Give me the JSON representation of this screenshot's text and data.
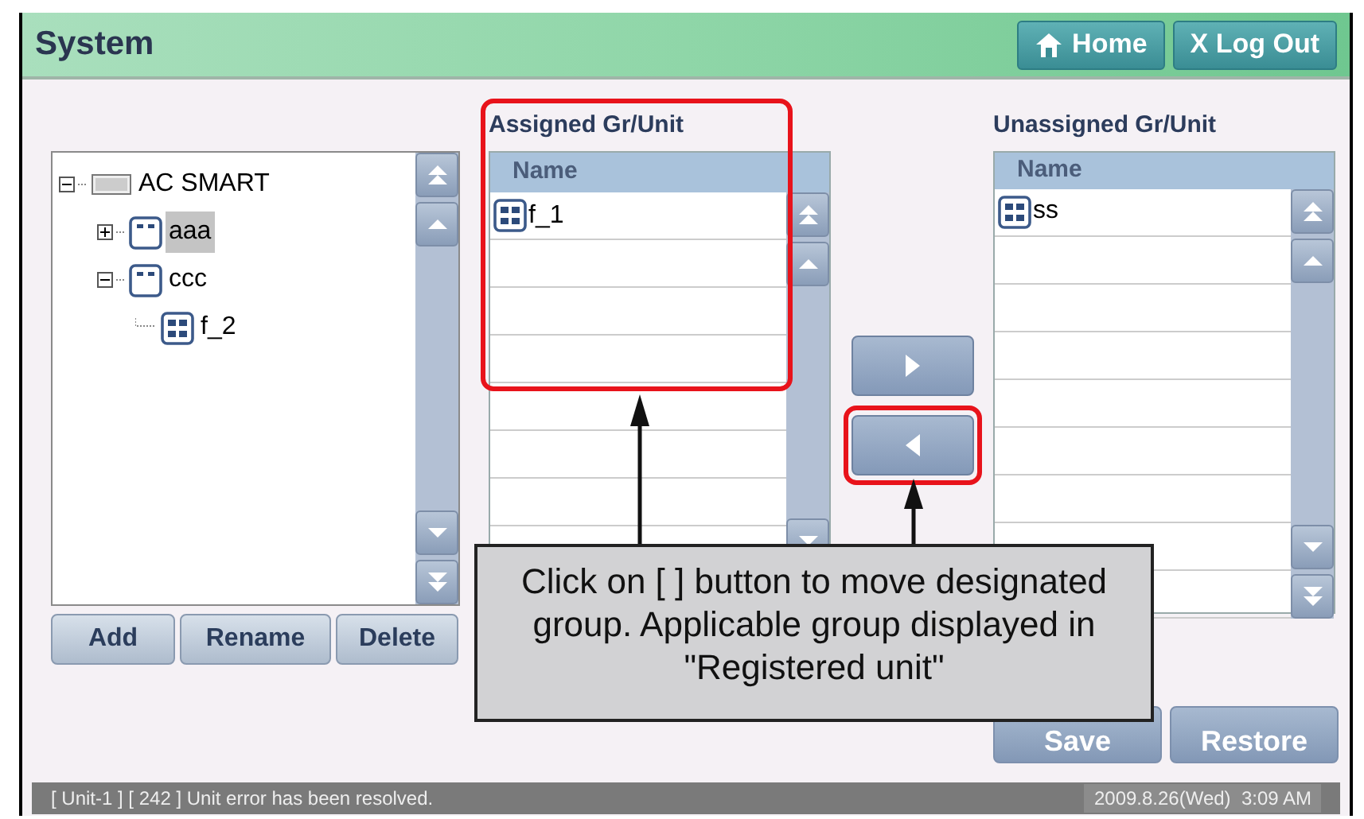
{
  "window": {
    "title": "System"
  },
  "header_buttons": [
    {
      "kind": "home",
      "label": "Home"
    },
    {
      "kind": "logout",
      "label": "X Log Out"
    }
  ],
  "tree": {
    "items": [
      {
        "label": "AC SMART",
        "kind": "root",
        "expanded": true,
        "selected": false,
        "children": [
          {
            "label": "aaa",
            "kind": "group",
            "expanded": false,
            "selected": true
          },
          {
            "label": "ccc",
            "kind": "group",
            "expanded": true,
            "selected": false,
            "children": [
              {
                "label": "f_2",
                "kind": "unit",
                "selected": false
              }
            ]
          }
        ]
      }
    ]
  },
  "tree_buttons": [
    "Add",
    "Rename",
    "Delete"
  ],
  "assigned": {
    "title": "Assigned Gr/Unit",
    "column": "Name",
    "rows": [
      {
        "name": "f_1"
      }
    ]
  },
  "unassigned": {
    "title": "Unassigned Gr/Unit",
    "column": "Name",
    "rows": [
      {
        "name": "ss"
      }
    ]
  },
  "move_buttons": [
    {
      "kind": "right",
      "highlighted": false
    },
    {
      "kind": "left",
      "highlighted": true
    }
  ],
  "footer_buttons": [
    "Save",
    "Restore"
  ],
  "callout": {
    "text": "Click on [ ] button to move designated group. Applicable group displayed in \"Registered unit\""
  },
  "status_bar": {
    "message": "[ Unit-1 ] [ 242 ] Unit error has been resolved.",
    "time": "2009.8.26(Wed)  3:09 AM"
  }
}
